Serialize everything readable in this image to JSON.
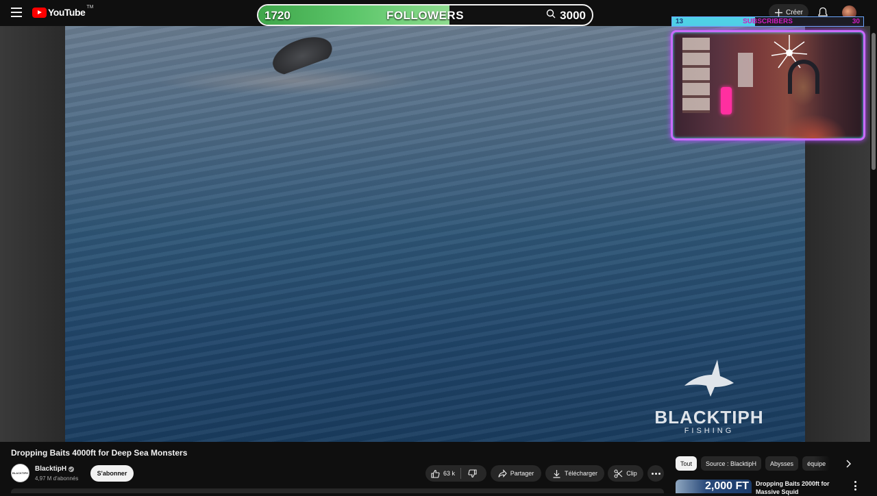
{
  "header": {
    "logo_text": "YouTube",
    "logo_tm": "TM",
    "create_label": "Créer"
  },
  "followers_goal": {
    "current": "1720",
    "label": "FOLLOWERS",
    "goal": "3000",
    "progress_fraction": 0.573,
    "fill_color": "#5cc66a"
  },
  "subscribers_goal": {
    "current": "13",
    "label": "SUBSCRIBERS",
    "goal": "30",
    "progress_fraction": 0.433,
    "fill_color": "#4fd1e6"
  },
  "video": {
    "watermark_title": "BLACKTIPH",
    "watermark_subtitle": "FISHING",
    "title": "Dropping Baits 4000ft for Deep Sea Monsters"
  },
  "channel": {
    "name": "BlacktipH",
    "subscribers": "4,97 M d'abonnés",
    "subscribe_label": "S'abonner",
    "avatar_text": "BLACKTIPH"
  },
  "actions": {
    "likes": "63 k",
    "share_label": "Partager",
    "download_label": "Télécharger",
    "clip_label": "Clip"
  },
  "chips": [
    {
      "label": "Tout"
    },
    {
      "label": "Source : BlacktipH"
    },
    {
      "label": "Abysses"
    },
    {
      "label": "équipe"
    }
  ],
  "recommended": {
    "thumb_text": "2,000 FT",
    "title": "Dropping Baits 2000ft for Massive Squid"
  },
  "colors": {
    "background": "#0f0f0f",
    "youtube_red": "#ff0000",
    "webcam_border": "#c96bff",
    "subscribers_text": "#d01cc0"
  }
}
